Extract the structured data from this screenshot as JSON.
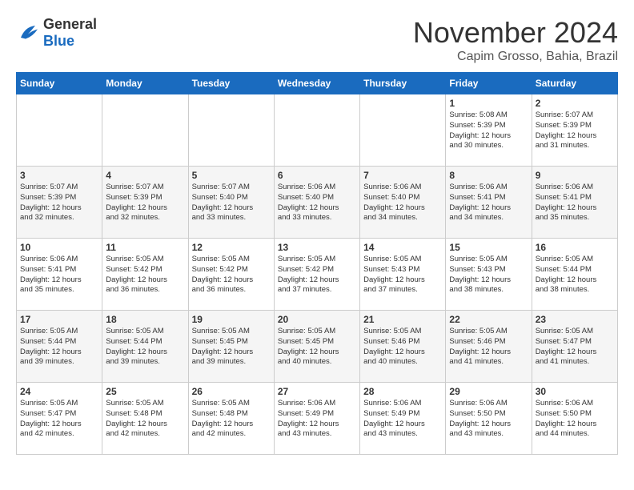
{
  "logo": {
    "general": "General",
    "blue": "Blue"
  },
  "title": "November 2024",
  "location": "Capim Grosso, Bahia, Brazil",
  "days_of_week": [
    "Sunday",
    "Monday",
    "Tuesday",
    "Wednesday",
    "Thursday",
    "Friday",
    "Saturday"
  ],
  "weeks": [
    [
      {
        "day": "",
        "info": ""
      },
      {
        "day": "",
        "info": ""
      },
      {
        "day": "",
        "info": ""
      },
      {
        "day": "",
        "info": ""
      },
      {
        "day": "",
        "info": ""
      },
      {
        "day": "1",
        "info": "Sunrise: 5:08 AM\nSunset: 5:39 PM\nDaylight: 12 hours\nand 30 minutes."
      },
      {
        "day": "2",
        "info": "Sunrise: 5:07 AM\nSunset: 5:39 PM\nDaylight: 12 hours\nand 31 minutes."
      }
    ],
    [
      {
        "day": "3",
        "info": "Sunrise: 5:07 AM\nSunset: 5:39 PM\nDaylight: 12 hours\nand 32 minutes."
      },
      {
        "day": "4",
        "info": "Sunrise: 5:07 AM\nSunset: 5:39 PM\nDaylight: 12 hours\nand 32 minutes."
      },
      {
        "day": "5",
        "info": "Sunrise: 5:07 AM\nSunset: 5:40 PM\nDaylight: 12 hours\nand 33 minutes."
      },
      {
        "day": "6",
        "info": "Sunrise: 5:06 AM\nSunset: 5:40 PM\nDaylight: 12 hours\nand 33 minutes."
      },
      {
        "day": "7",
        "info": "Sunrise: 5:06 AM\nSunset: 5:40 PM\nDaylight: 12 hours\nand 34 minutes."
      },
      {
        "day": "8",
        "info": "Sunrise: 5:06 AM\nSunset: 5:41 PM\nDaylight: 12 hours\nand 34 minutes."
      },
      {
        "day": "9",
        "info": "Sunrise: 5:06 AM\nSunset: 5:41 PM\nDaylight: 12 hours\nand 35 minutes."
      }
    ],
    [
      {
        "day": "10",
        "info": "Sunrise: 5:06 AM\nSunset: 5:41 PM\nDaylight: 12 hours\nand 35 minutes."
      },
      {
        "day": "11",
        "info": "Sunrise: 5:05 AM\nSunset: 5:42 PM\nDaylight: 12 hours\nand 36 minutes."
      },
      {
        "day": "12",
        "info": "Sunrise: 5:05 AM\nSunset: 5:42 PM\nDaylight: 12 hours\nand 36 minutes."
      },
      {
        "day": "13",
        "info": "Sunrise: 5:05 AM\nSunset: 5:42 PM\nDaylight: 12 hours\nand 37 minutes."
      },
      {
        "day": "14",
        "info": "Sunrise: 5:05 AM\nSunset: 5:43 PM\nDaylight: 12 hours\nand 37 minutes."
      },
      {
        "day": "15",
        "info": "Sunrise: 5:05 AM\nSunset: 5:43 PM\nDaylight: 12 hours\nand 38 minutes."
      },
      {
        "day": "16",
        "info": "Sunrise: 5:05 AM\nSunset: 5:44 PM\nDaylight: 12 hours\nand 38 minutes."
      }
    ],
    [
      {
        "day": "17",
        "info": "Sunrise: 5:05 AM\nSunset: 5:44 PM\nDaylight: 12 hours\nand 39 minutes."
      },
      {
        "day": "18",
        "info": "Sunrise: 5:05 AM\nSunset: 5:44 PM\nDaylight: 12 hours\nand 39 minutes."
      },
      {
        "day": "19",
        "info": "Sunrise: 5:05 AM\nSunset: 5:45 PM\nDaylight: 12 hours\nand 39 minutes."
      },
      {
        "day": "20",
        "info": "Sunrise: 5:05 AM\nSunset: 5:45 PM\nDaylight: 12 hours\nand 40 minutes."
      },
      {
        "day": "21",
        "info": "Sunrise: 5:05 AM\nSunset: 5:46 PM\nDaylight: 12 hours\nand 40 minutes."
      },
      {
        "day": "22",
        "info": "Sunrise: 5:05 AM\nSunset: 5:46 PM\nDaylight: 12 hours\nand 41 minutes."
      },
      {
        "day": "23",
        "info": "Sunrise: 5:05 AM\nSunset: 5:47 PM\nDaylight: 12 hours\nand 41 minutes."
      }
    ],
    [
      {
        "day": "24",
        "info": "Sunrise: 5:05 AM\nSunset: 5:47 PM\nDaylight: 12 hours\nand 42 minutes."
      },
      {
        "day": "25",
        "info": "Sunrise: 5:05 AM\nSunset: 5:48 PM\nDaylight: 12 hours\nand 42 minutes."
      },
      {
        "day": "26",
        "info": "Sunrise: 5:05 AM\nSunset: 5:48 PM\nDaylight: 12 hours\nand 42 minutes."
      },
      {
        "day": "27",
        "info": "Sunrise: 5:06 AM\nSunset: 5:49 PM\nDaylight: 12 hours\nand 43 minutes."
      },
      {
        "day": "28",
        "info": "Sunrise: 5:06 AM\nSunset: 5:49 PM\nDaylight: 12 hours\nand 43 minutes."
      },
      {
        "day": "29",
        "info": "Sunrise: 5:06 AM\nSunset: 5:50 PM\nDaylight: 12 hours\nand 43 minutes."
      },
      {
        "day": "30",
        "info": "Sunrise: 5:06 AM\nSunset: 5:50 PM\nDaylight: 12 hours\nand 44 minutes."
      }
    ]
  ]
}
